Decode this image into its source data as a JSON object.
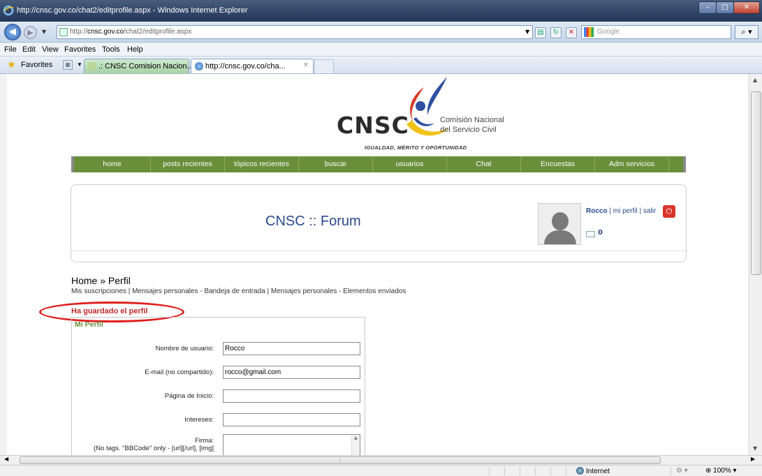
{
  "window": {
    "title": "http://cnsc.gov.co/chat2/editprofile.aspx - Windows Internet Explorer"
  },
  "address": {
    "url_prefix": "http://",
    "url_domain": "cnsc.gov.co",
    "url_path": "/chat2/editprofile.aspx",
    "search_placeholder": "Google"
  },
  "menu": [
    "File",
    "Edit",
    "View",
    "Favorites",
    "Tools",
    "Help"
  ],
  "favorites": {
    "label": "Favorites",
    "tabs": [
      ".: CNSC Comision Nacion...",
      "http://cnsc.gov.co/cha..."
    ]
  },
  "logo": {
    "acronym": "CNSC",
    "org_line1": "Comisión Nacional",
    "org_line2": "del Servicio Civil",
    "motto": "IGUALDAD, MÉRITO Y OPORTUNIDAD"
  },
  "nav": [
    "home",
    "posts recientes",
    "tópicos recientes",
    "buscar",
    "usuarios",
    "Chat",
    "Encuestas",
    "Adm servicios"
  ],
  "forum": {
    "title": "CNSC :: Forum",
    "username": "Rocco",
    "profile_link": "mi perfil",
    "logout_link": "salir",
    "messages": "0"
  },
  "breadcrumb": "Home » Perfil",
  "sublinks": "Mis suscripciones | Mensajes personales - Bandeja de entrada | Mensajes personales - Elementos enviados",
  "saved_message": "Ha guardado el perfil",
  "profile": {
    "panel_title": "Mi Perfil",
    "fields": [
      {
        "label": "Nombre de usuario:",
        "value": "Rocco"
      },
      {
        "label": "E-mail (no compartido):",
        "value": "rocco@gmail.com"
      },
      {
        "label": "Página de Inicio:",
        "value": ""
      },
      {
        "label": "Intereses:",
        "value": ""
      }
    ],
    "firma_label": "Firma:",
    "firma_note": "(No tags. \"BBCode\" only - [url][/url], [img]"
  },
  "status": {
    "zone": "Internet",
    "zoom": "100%"
  }
}
